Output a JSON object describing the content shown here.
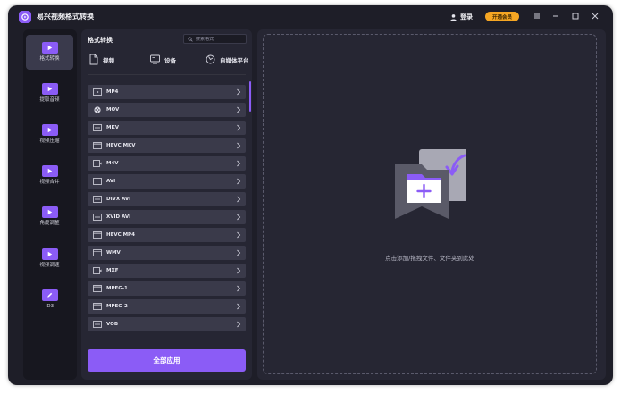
{
  "app": {
    "title": "易兴视频格式转换",
    "login_label": "登录",
    "vip_label": "开通会员"
  },
  "sidebar": {
    "items": [
      {
        "label": "格式转换",
        "icon": "video-convert-icon",
        "active": true
      },
      {
        "label": "提取音频",
        "icon": "extract-audio-icon",
        "active": false
      },
      {
        "label": "视频压缩",
        "icon": "compress-icon",
        "active": false
      },
      {
        "label": "视频合并",
        "icon": "merge-icon",
        "active": false
      },
      {
        "label": "角度调整",
        "icon": "rotate-icon",
        "active": false
      },
      {
        "label": "视频调速",
        "icon": "speed-icon",
        "active": false
      },
      {
        "label": "ID3",
        "icon": "edit-tag-icon",
        "active": false
      }
    ]
  },
  "format_panel": {
    "title": "格式转换",
    "search_placeholder": "搜索格式",
    "categories": [
      {
        "label": "视频",
        "icon": "file-icon"
      },
      {
        "label": "设备",
        "icon": "device-icon"
      },
      {
        "label": "自媒体平台",
        "icon": "platform-icon"
      }
    ],
    "formats": [
      {
        "name": "MP4",
        "icon": "mp4-icon"
      },
      {
        "name": "MOV",
        "icon": "mov-reel-icon"
      },
      {
        "name": "MKV",
        "icon": "mkv-icon"
      },
      {
        "name": "HEVC MKV",
        "icon": "hevc-mkv-icon"
      },
      {
        "name": "M4V",
        "icon": "m4v-icon"
      },
      {
        "name": "AVI",
        "icon": "avi-icon"
      },
      {
        "name": "DIVX AVI",
        "icon": "divx-icon"
      },
      {
        "name": "XVID AVI",
        "icon": "xvid-icon"
      },
      {
        "name": "HEVC MP4",
        "icon": "hevc-mp4-icon"
      },
      {
        "name": "WMV",
        "icon": "wmv-icon"
      },
      {
        "name": "MXF",
        "icon": "mxf-icon"
      },
      {
        "name": "MPEG-1",
        "icon": "mpeg1-icon"
      },
      {
        "name": "MPEG-2",
        "icon": "mpeg2-icon"
      },
      {
        "name": "VOB",
        "icon": "vob-icon"
      }
    ],
    "apply_all_label": "全部应用"
  },
  "drop_zone": {
    "hint": "点击添加/拖拽文件、文件夹到此处"
  },
  "colors": {
    "accent": "#8b5cf6",
    "vip": "#f5a623",
    "background": "#1e1e28",
    "panel": "#262633",
    "row": "#3a3a4a"
  }
}
